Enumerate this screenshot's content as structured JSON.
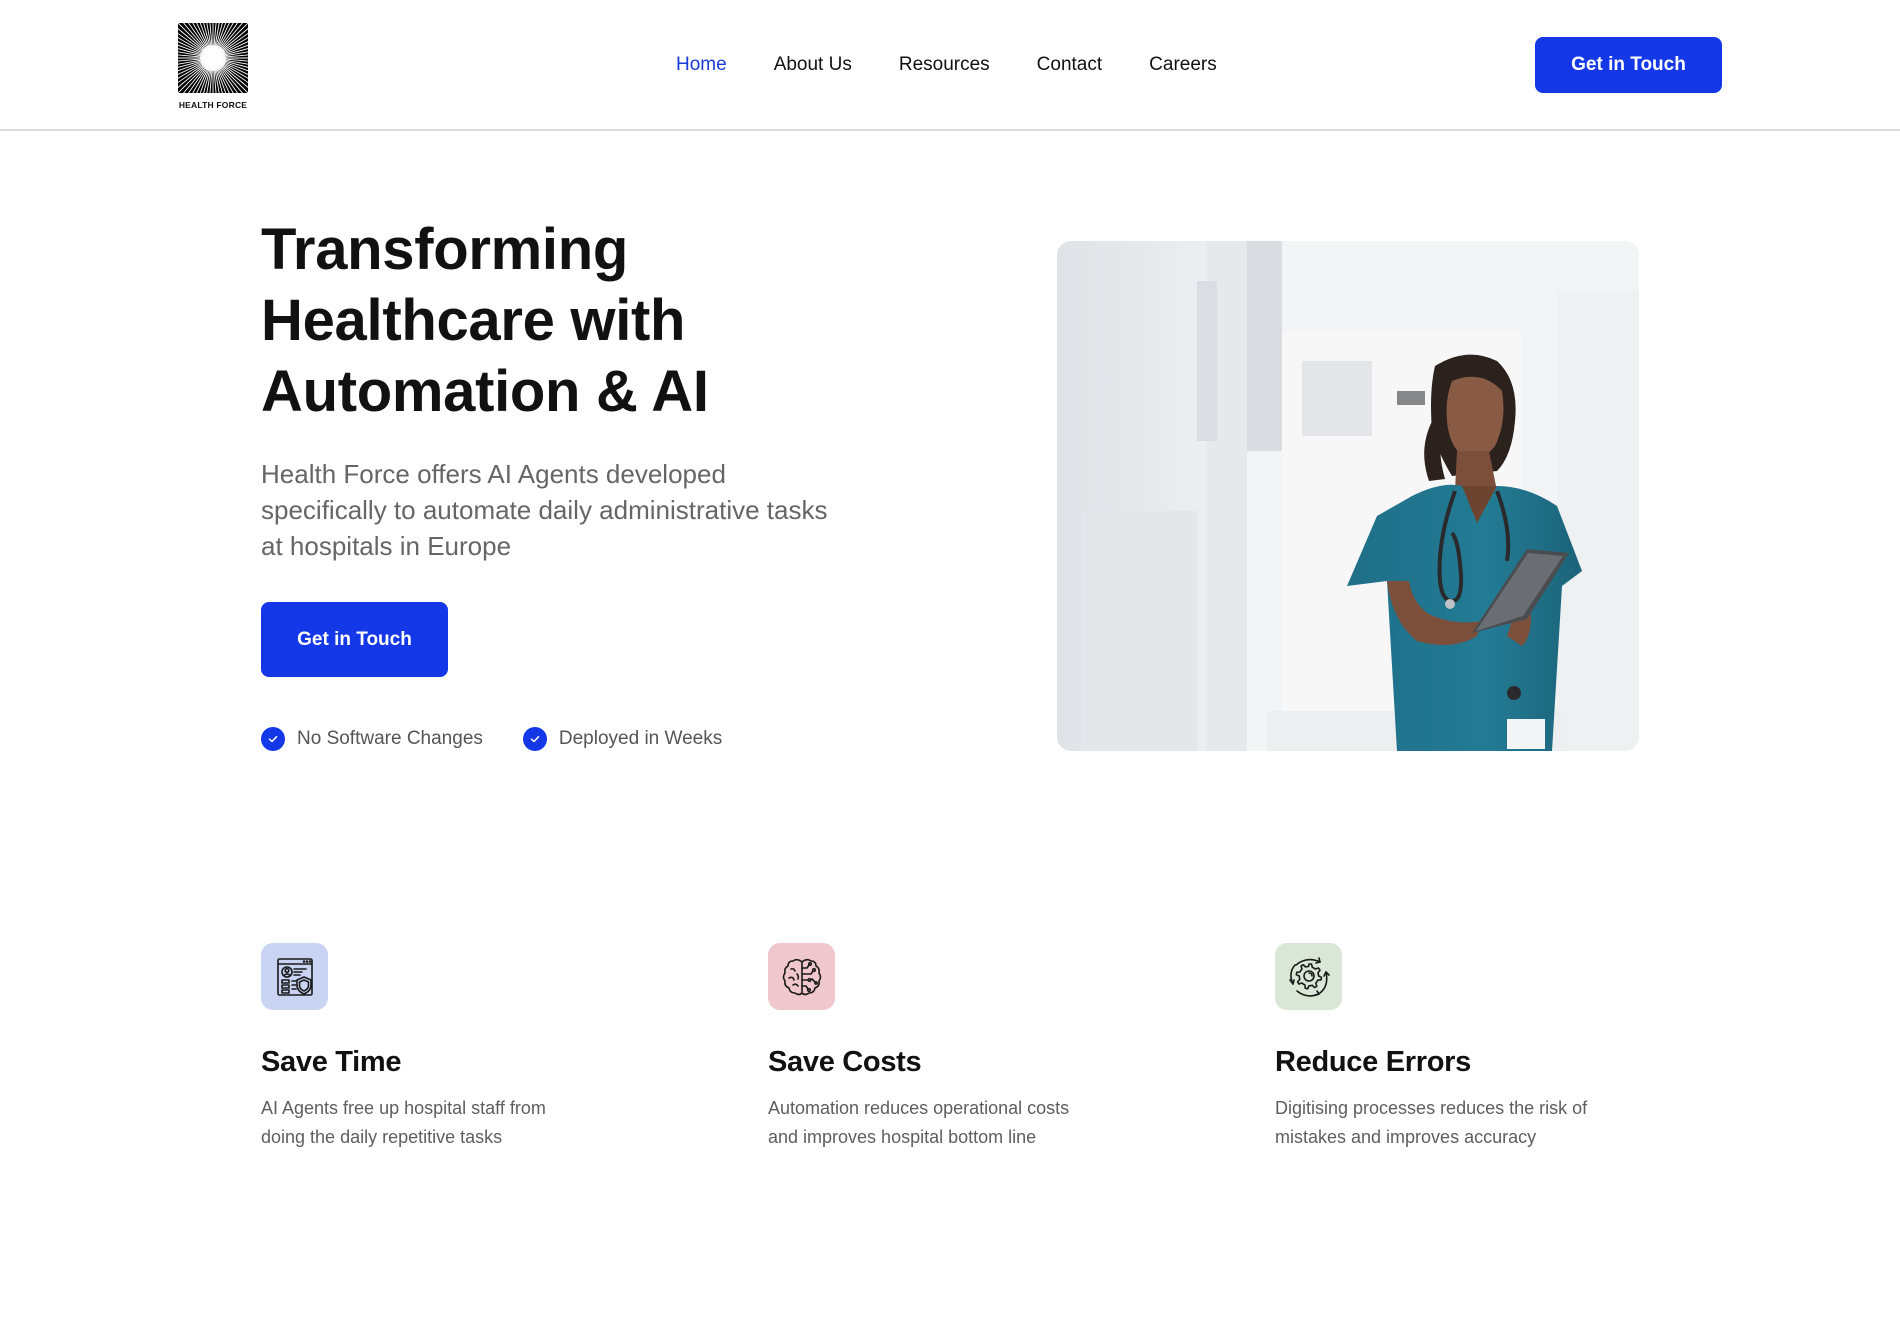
{
  "header": {
    "logo_text": "HEALTH FORCE",
    "nav": [
      {
        "label": "Home",
        "active": true
      },
      {
        "label": "About Us",
        "active": false
      },
      {
        "label": "Resources",
        "active": false
      },
      {
        "label": "Contact",
        "active": false
      },
      {
        "label": "Careers",
        "active": false
      }
    ],
    "cta_label": "Get in Touch"
  },
  "hero": {
    "title_lines": [
      "Transforming",
      "Healthcare with",
      "Automation & AI"
    ],
    "subtitle_lines": [
      "Health Force offers AI Agents developed",
      "specifically to automate daily administrative tasks",
      "at hospitals in Europe"
    ],
    "cta_label": "Get in Touch",
    "checks": [
      {
        "icon": "check-circle-icon",
        "label": "No Software Changes"
      },
      {
        "icon": "check-circle-icon",
        "label": "Deployed in Weeks"
      }
    ],
    "image_alt": "Nurse in teal scrubs with stethoscope using a tablet in a hospital corridor"
  },
  "features": [
    {
      "icon": "profile-shield-icon",
      "icon_bg": "#c9d3f2",
      "title": "Save Time",
      "desc_lines": [
        "AI Agents free up hospital staff from",
        "doing the daily repetitive tasks"
      ]
    },
    {
      "icon": "brain-circuit-icon",
      "icon_bg": "#efc7cc",
      "title": "Save Costs",
      "desc_lines": [
        "Automation reduces operational costs",
        "and improves hospital bottom line"
      ]
    },
    {
      "icon": "gear-cycle-icon",
      "icon_bg": "#dbe7d6",
      "title": "Reduce Errors",
      "desc_lines": [
        "Digitising processes reduces the risk of",
        "mistakes and improves accuracy"
      ]
    }
  ],
  "colors": {
    "accent": "#1438e8",
    "nav_active": "#1a3bd8",
    "text_dark": "#111111",
    "text_muted": "#666666"
  }
}
